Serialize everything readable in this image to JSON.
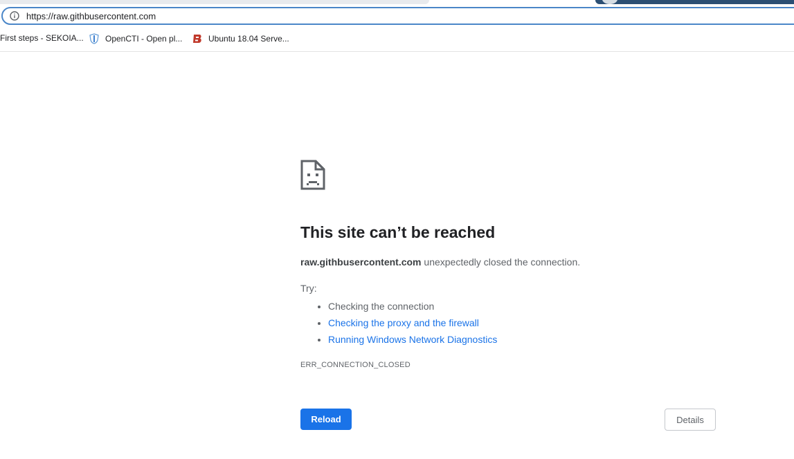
{
  "browser": {
    "url": "https://raw.githbusercontent.com",
    "bookmarks": [
      {
        "label": "First steps - SEKOIA...",
        "icon": "none"
      },
      {
        "label": "OpenCTI - Open pl...",
        "icon": "opencti-shield-icon"
      },
      {
        "label": "Ubuntu 18.04 Serve...",
        "icon": "b-logo-icon"
      }
    ]
  },
  "error": {
    "title": "This site can’t be reached",
    "host": "raw.githbusercontent.com",
    "message": " unexpectedly closed the connection.",
    "try_label": "Try:",
    "suggestions": [
      {
        "text": "Checking the connection",
        "link": false
      },
      {
        "text": "Checking the proxy and the firewall",
        "link": true
      },
      {
        "text": "Running Windows Network Diagnostics",
        "link": true
      }
    ],
    "code": "ERR_CONNECTION_CLOSED"
  },
  "buttons": {
    "reload": "Reload",
    "details": "Details"
  },
  "colors": {
    "accent": "#1a73e8",
    "text": "#202124",
    "secondary": "#5f6368"
  }
}
